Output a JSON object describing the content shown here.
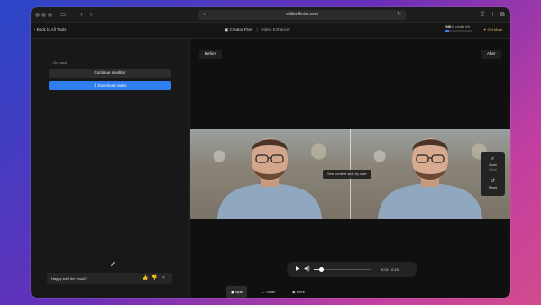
{
  "browser": {
    "url": "editor.flixier.com",
    "icons": [
      "sidebar-icon",
      "back-icon",
      "forward-icon",
      "lock-icon",
      "reload-icon",
      "share-icon",
      "new-tab-icon",
      "tabs-icon"
    ]
  },
  "header": {
    "back_label": "Back to All Tools",
    "breadcrumb_root": "Creator Flow",
    "breadcrumb_current": "Video Enhancer",
    "credits_value": "7/45",
    "credits_label": "AI credits left",
    "credits_fraction": 0.16,
    "get_more_label": "Get More"
  },
  "left_panel": {
    "go_back_label": "Go back",
    "continue_label": "Continue in editor",
    "download_label": "Download video",
    "feedback_question": "Happy with the result?"
  },
  "canvas": {
    "before_label": "Before",
    "after_label": "After",
    "hint": "See content side by side",
    "zoom_label": "Zoom",
    "zoom_sub": "Scroll",
    "reset_label": "Reset"
  },
  "player": {
    "time": "0:02 / 0:15",
    "progress": 0.13
  },
  "view_modes": {
    "items": [
      "Split",
      "Slider",
      "Peek"
    ],
    "active": "Split"
  },
  "colors": {
    "accent": "#2f7ef0",
    "get_more": "#e0c060"
  }
}
